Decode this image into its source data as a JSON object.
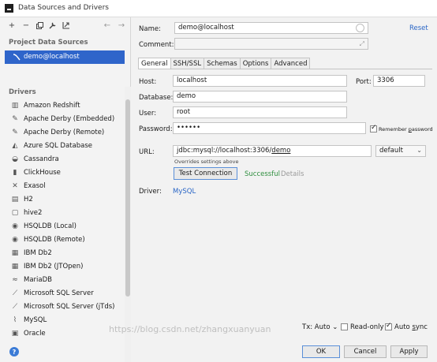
{
  "window": {
    "title": "Data Sources and Drivers"
  },
  "sidebar": {
    "project_section_title": "Project Data Sources",
    "selected_data_source": "demo@localhost",
    "drivers_section_title": "Drivers",
    "drivers": [
      {
        "label": "Amazon Redshift",
        "icon": "redshift-icon"
      },
      {
        "label": "Apache Derby (Embedded)",
        "icon": "derby-icon"
      },
      {
        "label": "Apache Derby (Remote)",
        "icon": "derby-icon"
      },
      {
        "label": "Azure SQL Database",
        "icon": "azure-icon"
      },
      {
        "label": "Cassandra",
        "icon": "cassandra-icon"
      },
      {
        "label": "ClickHouse",
        "icon": "clickhouse-icon"
      },
      {
        "label": "Exasol",
        "icon": "exasol-icon"
      },
      {
        "label": "H2",
        "icon": "h2-icon"
      },
      {
        "label": "hive2",
        "icon": "hive-icon"
      },
      {
        "label": "HSQLDB (Local)",
        "icon": "hsqldb-icon"
      },
      {
        "label": "HSQLDB (Remote)",
        "icon": "hsqldb-icon"
      },
      {
        "label": "IBM Db2",
        "icon": "db2-icon"
      },
      {
        "label": "IBM Db2 (JTOpen)",
        "icon": "db2-icon"
      },
      {
        "label": "MariaDB",
        "icon": "mariadb-icon"
      },
      {
        "label": "Microsoft SQL Server",
        "icon": "sqlserver-icon"
      },
      {
        "label": "Microsoft SQL Server (jTds)",
        "icon": "sqlserver-icon"
      },
      {
        "label": "MySQL",
        "icon": "mysql-icon"
      },
      {
        "label": "Oracle",
        "icon": "oracle-icon"
      }
    ]
  },
  "form": {
    "name_label": "Name:",
    "name_value": "demo@localhost",
    "reset_label": "Reset",
    "comment_label": "Comment:",
    "comment_value": "",
    "tabs": [
      "General",
      "SSH/SSL",
      "Schemas",
      "Options",
      "Advanced"
    ],
    "active_tab": "General",
    "host_label": "Host:",
    "host_value": "localhost",
    "port_label": "Port:",
    "port_value": "3306",
    "database_label": "Database:",
    "database_value": "demo",
    "user_label": "User:",
    "user_value": "root",
    "password_label": "Password:",
    "password_value": "••••••",
    "remember_password_pre": "Remember ",
    "remember_password_key": "p",
    "remember_password_post": "assword",
    "remember_password_checked": true,
    "url_label": "URL:",
    "url_prefix": "jdbc:mysql://localhost:3306/",
    "url_db": "demo",
    "url_scheme": "default",
    "overrides_hint": "Overrides settings above",
    "test_connection_label": "Test Connection",
    "status": "Successful",
    "details_label": "Details",
    "driver_label": "Driver:",
    "driver_value": "MySQL"
  },
  "footer": {
    "tx_label": "Tx: Auto",
    "read_only_label": "Read-only",
    "read_only_checked": false,
    "auto_sync_pre": "Auto ",
    "auto_sync_key": "s",
    "auto_sync_post": "ync",
    "auto_sync_checked": true,
    "ok_label": "OK",
    "cancel_label": "Cancel",
    "apply_label": "Apply"
  },
  "watermark": "https://blog.csdn.net/zhangxuanyuan",
  "colors": {
    "selection": "#2f65ca",
    "link": "#2a66c6",
    "success": "#2f8f3f"
  }
}
